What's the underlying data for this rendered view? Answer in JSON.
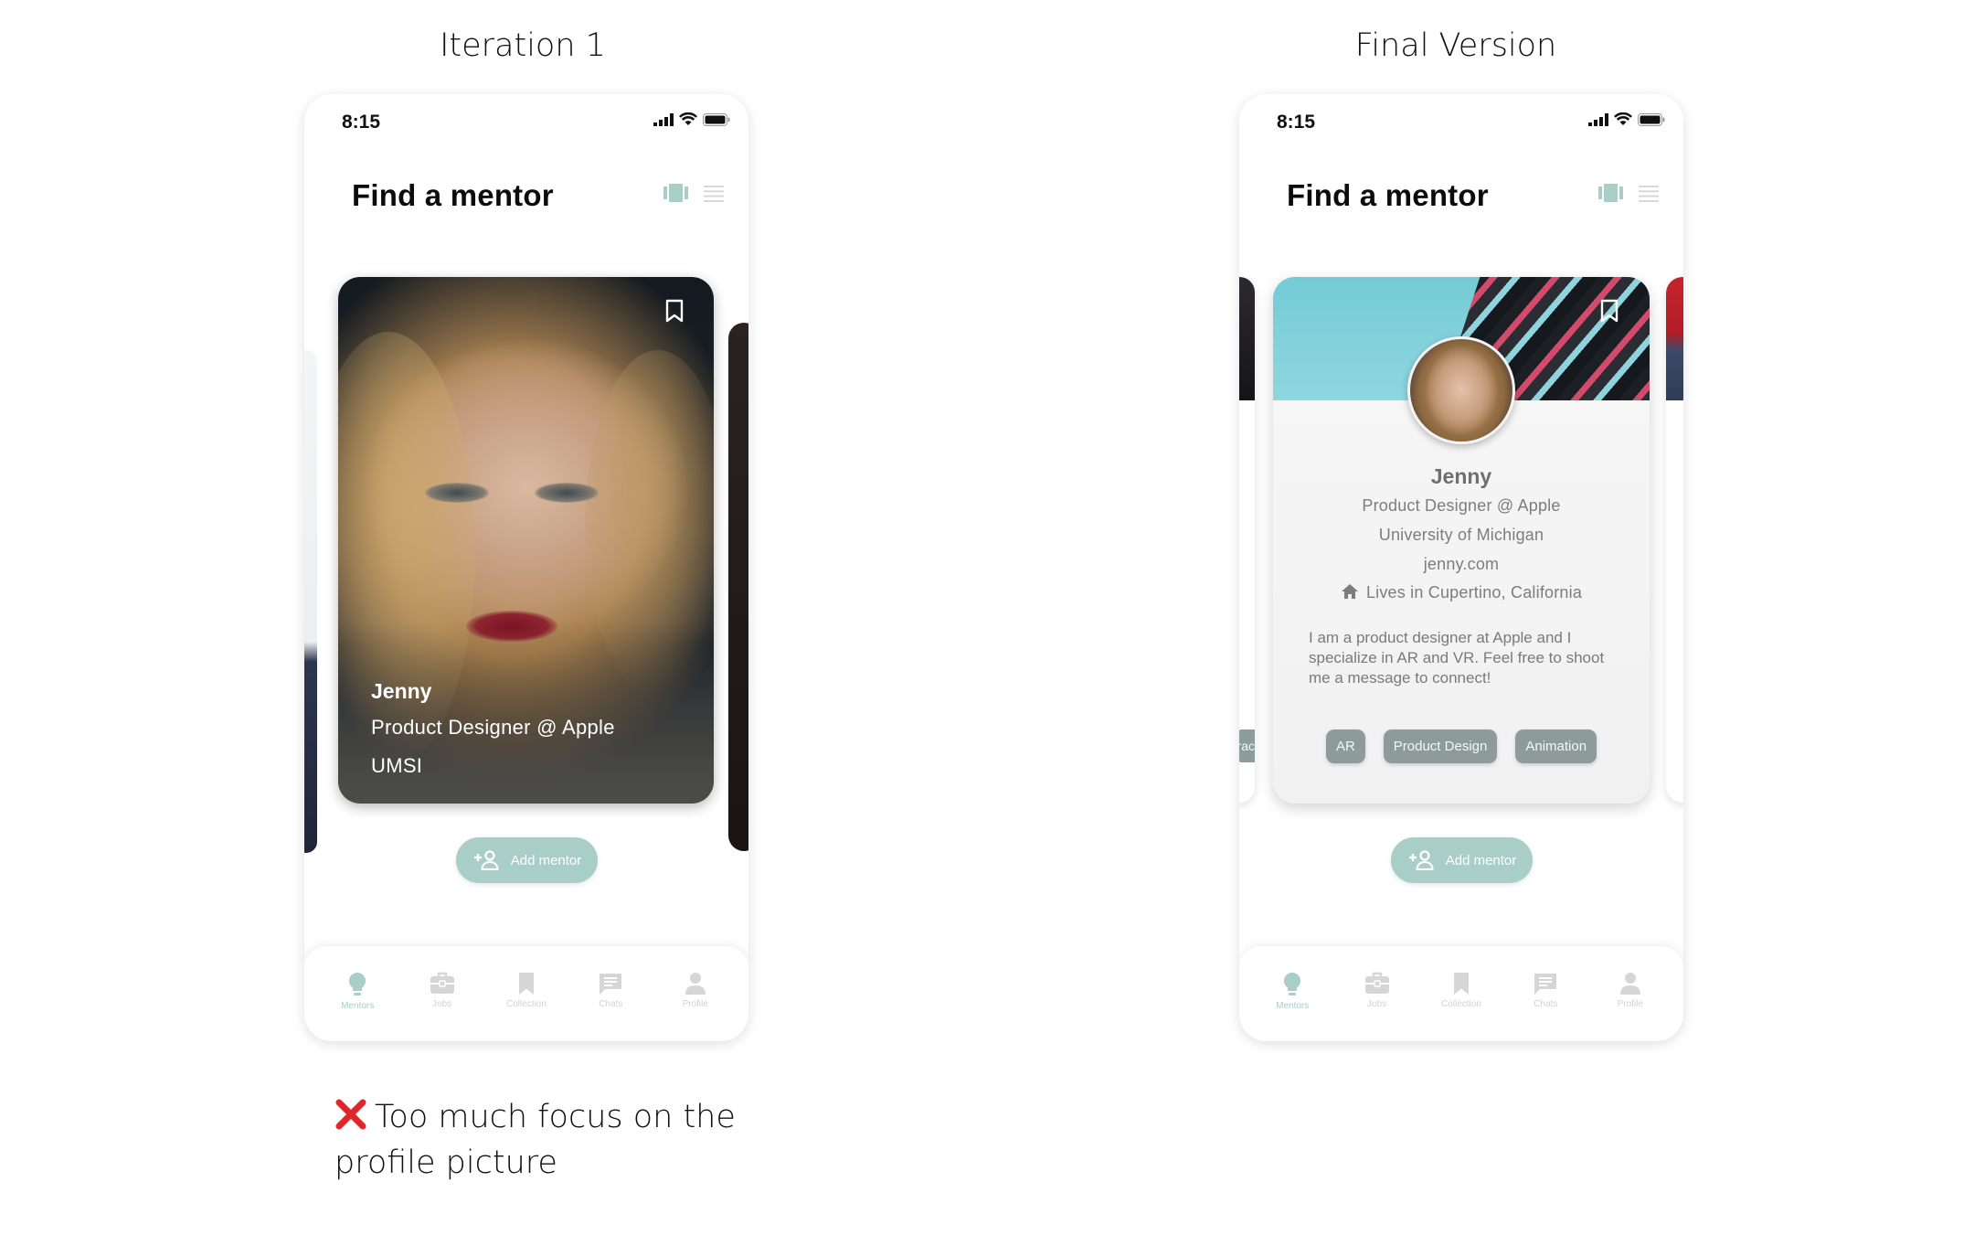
{
  "columns": {
    "left_title": "Iteration 1",
    "right_title": "Final Version"
  },
  "phone": {
    "time": "8:15",
    "app_title": "Find a mentor",
    "add_button": "Add mentor",
    "tabs": [
      {
        "label": "Mentors",
        "icon": "lightbulb-icon",
        "active": true
      },
      {
        "label": "Jobs",
        "icon": "briefcase-icon",
        "active": false
      },
      {
        "label": "Collection",
        "icon": "bookmark-icon",
        "active": false
      },
      {
        "label": "Chats",
        "icon": "chat-icon",
        "active": false
      },
      {
        "label": "Profile",
        "icon": "person-icon",
        "active": false
      }
    ]
  },
  "iteration_card": {
    "name": "Jenny",
    "title": "Product Designer @ Apple",
    "school": "UMSI"
  },
  "final_card": {
    "name": "Jenny",
    "title": "Product Designer @ Apple",
    "school": "University of Michigan",
    "website": "jenny.com",
    "location": "Lives in Cupertino, California",
    "bio": "I am a product designer at Apple and I specialize in AR and VR. Feel free to shoot me a message to connect!",
    "tags": [
      "AR",
      "Product Design",
      "Animation"
    ],
    "peek_tag_fragment": "rac"
  },
  "note": {
    "text": "Too much focus on the profile picture"
  },
  "colors": {
    "accent": "#a9cdc7",
    "tag": "#8d9c9b",
    "error": "#e0262b"
  }
}
